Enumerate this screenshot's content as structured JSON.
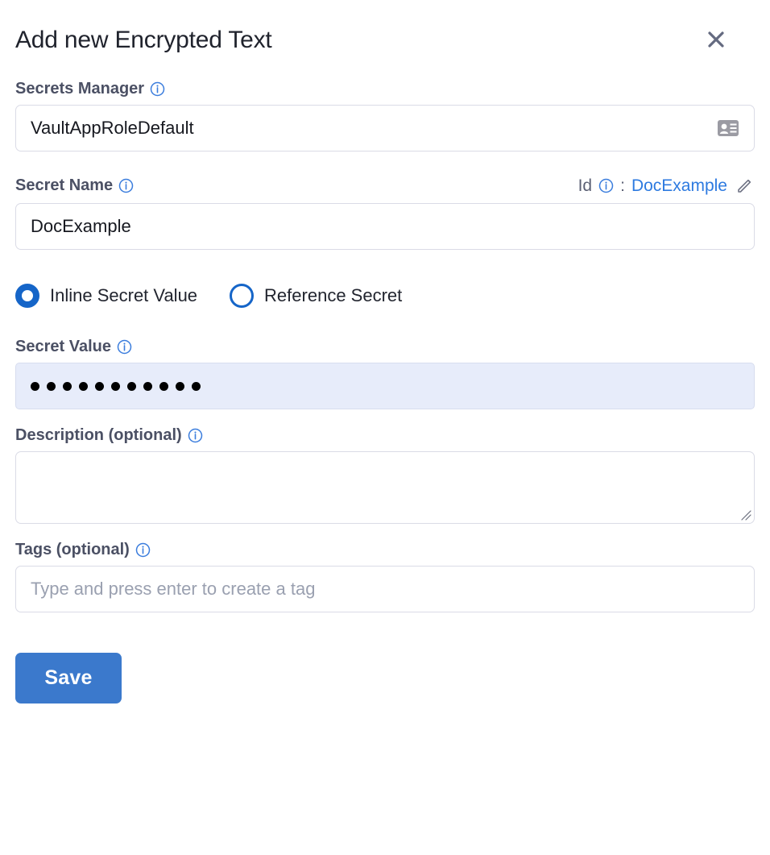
{
  "dialog": {
    "title": "Add new Encrypted Text",
    "close_label": "Close",
    "close_icon": "close-icon"
  },
  "secrets_manager": {
    "label": "Secrets Manager",
    "info_icon": "info-icon",
    "value": "VaultAppRoleDefault",
    "adornment_icon": "id-badge-icon"
  },
  "secret_name": {
    "label": "Secret Name",
    "info_icon": "info-icon",
    "value": "DocExample",
    "id_key": "Id",
    "id_info_icon": "info-icon",
    "id_separator": ":",
    "id_value": "DocExample",
    "edit_icon": "pencil-icon"
  },
  "secret_mode": {
    "options": [
      {
        "label": "Inline Secret Value",
        "selected": true
      },
      {
        "label": "Reference Secret",
        "selected": false
      }
    ]
  },
  "secret_value": {
    "label": "Secret Value",
    "info_icon": "info-icon",
    "masked_char_count": 11,
    "masked_display": "•••••••••••"
  },
  "description": {
    "label": "Description (optional)",
    "info_icon": "info-icon",
    "value": "",
    "resize_handle_icon": "resize-grip-icon"
  },
  "tags": {
    "label": "Tags (optional)",
    "info_icon": "info-icon",
    "value": "",
    "placeholder": "Type and press enter to create a tag"
  },
  "actions": {
    "save_label": "Save"
  },
  "colors": {
    "accent_blue": "#3b79cc",
    "link_blue": "#2d7ae0",
    "info_blue": "#3b7ddd",
    "radio_blue": "#1565c8",
    "secret_field_bg": "#e7ecfa",
    "secret_field_border": "#d7ddef",
    "input_border": "#dadbe6",
    "label_gray": "#4b5064",
    "title_dark": "#20232d",
    "placeholder_gray": "#9aa0b0",
    "icon_gray": "#646a80"
  }
}
